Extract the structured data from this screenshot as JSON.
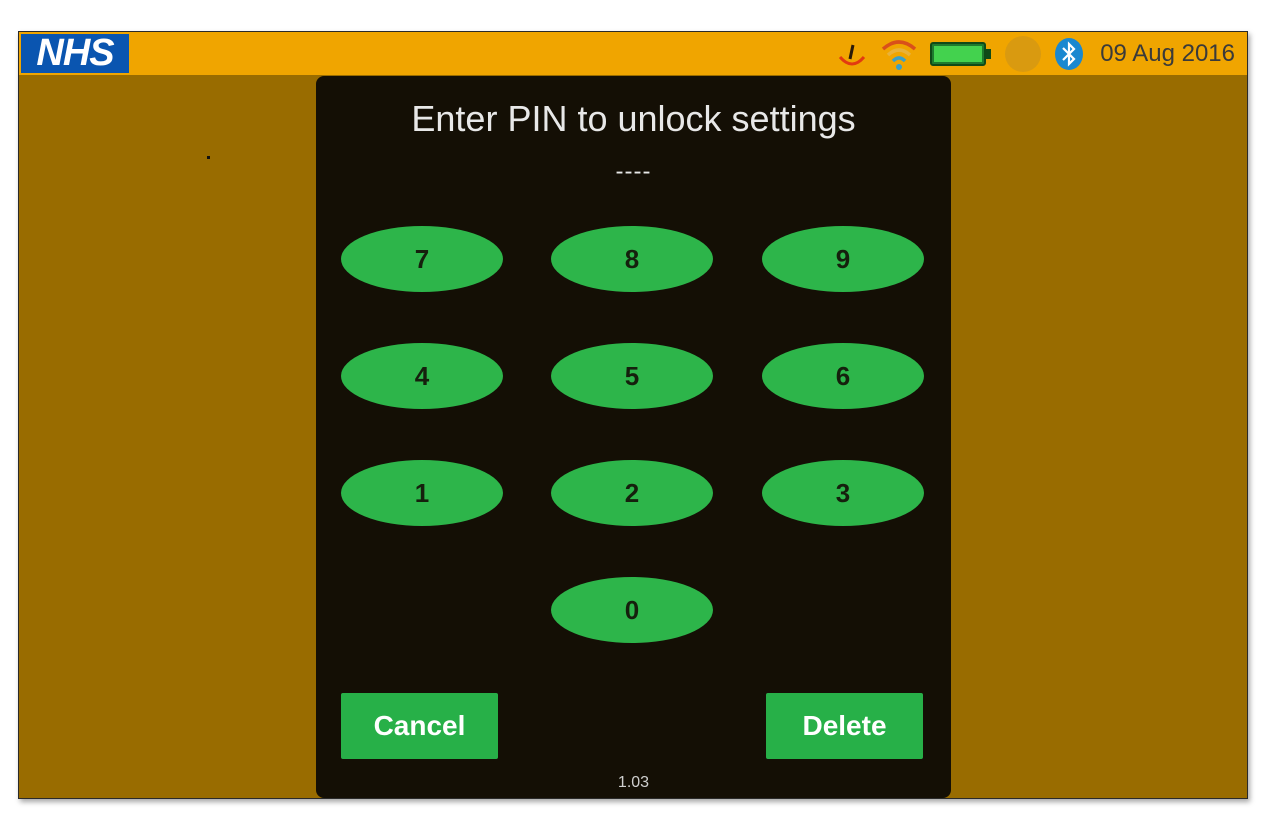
{
  "statusbar": {
    "logo_text": "NHS",
    "date": "09 Aug 2016",
    "icons": [
      "scale-icon",
      "wifi-icon",
      "battery-icon",
      "status-circle-icon",
      "bluetooth-icon"
    ],
    "colors": {
      "bar": "#f0a500",
      "logo_bg": "#0a55b0"
    }
  },
  "dialog": {
    "title": "Enter PIN to unlock settings",
    "pin_display": "----",
    "keys": [
      "7",
      "8",
      "9",
      "4",
      "5",
      "6",
      "1",
      "2",
      "3",
      "0"
    ],
    "cancel_label": "Cancel",
    "delete_label": "Delete",
    "version": "1.03",
    "colors": {
      "background": "#140f05",
      "key": "#2db54a"
    }
  },
  "screen": {
    "background": "#996c00"
  }
}
